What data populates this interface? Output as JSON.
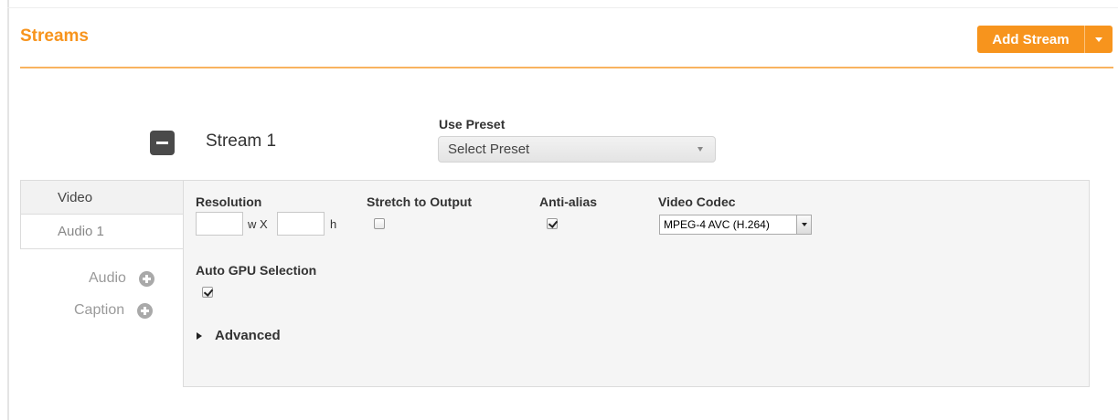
{
  "header": {
    "title": "Streams",
    "add_stream_label": "Add Stream",
    "accent_color": "#f7941d"
  },
  "stream": {
    "name": "Stream 1",
    "preset_label": "Use Preset",
    "preset_value": "Select Preset"
  },
  "tabs": [
    {
      "label": "Video",
      "active": true
    },
    {
      "label": "Audio 1",
      "active": false
    }
  ],
  "add_tracks": [
    {
      "label": "Audio",
      "icon": "plus-circle-icon"
    },
    {
      "label": "Caption",
      "icon": "plus-circle-icon"
    }
  ],
  "video": {
    "resolution_label": "Resolution",
    "width_value": "",
    "height_value": "",
    "width_unit": "w X",
    "height_unit": "h",
    "stretch_label": "Stretch to Output",
    "stretch_checked": false,
    "antialias_label": "Anti-alias",
    "antialias_checked": true,
    "codec_label": "Video Codec",
    "codec_value": "MPEG-4 AVC (H.264)",
    "gpu_label": "Auto GPU Selection",
    "gpu_checked": true,
    "advanced_label": "Advanced"
  }
}
